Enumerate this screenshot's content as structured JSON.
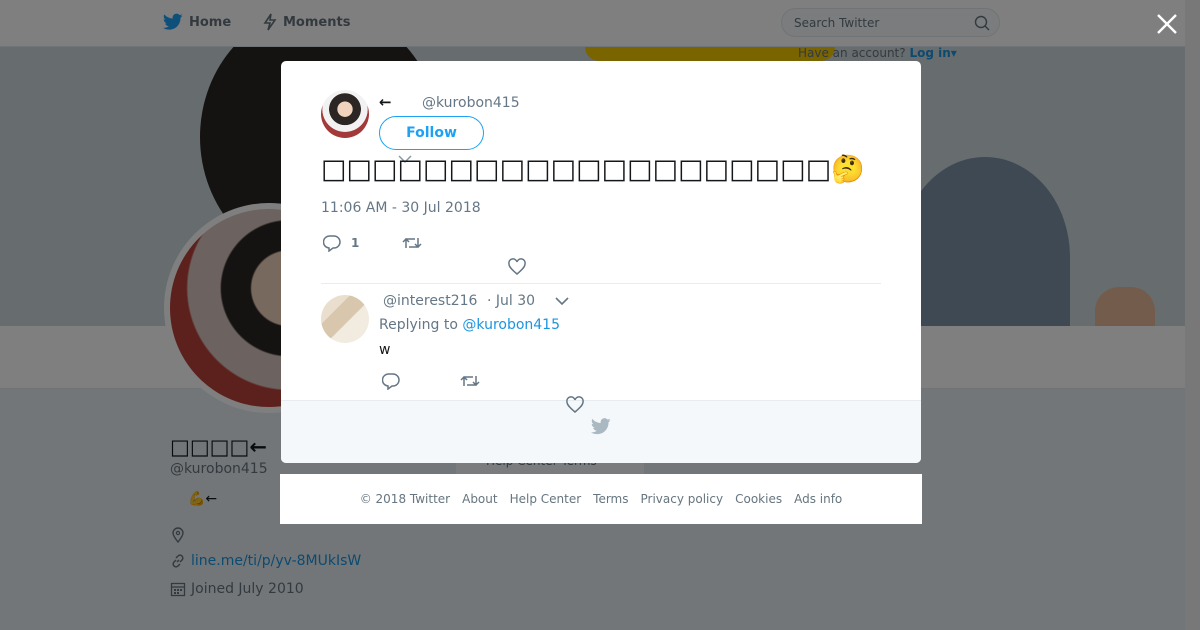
{
  "brand": {
    "accent": "#1da1f2",
    "link": "#1b95e0"
  },
  "topbar": {
    "home_label": "Home",
    "moments_label": "Moments",
    "search_placeholder": "Search Twitter",
    "account_prompt": "Have an account?",
    "login_label": "Log in"
  },
  "profile": {
    "name": "□□□□←",
    "handle": "@kurobon415",
    "bio": "💪←",
    "link": "line.me/ti/p/yv-8MUkIsW",
    "joined": "Joined July 2010"
  },
  "background_card": {
    "text": "Help Center  Terms"
  },
  "tweet": {
    "author_name": "←",
    "author_handle": "@kurobon415",
    "follow_label": "Follow",
    "text": "□□□□□□□□□□□□□□□□□□□□🤔",
    "timestamp": "11:06 AM - 30 Jul 2018",
    "reply_count": "1"
  },
  "reply": {
    "handle": "@interest216",
    "date": "· Jul 30",
    "replying_prefix": "Replying to",
    "replying_handle": "@kurobon415",
    "text": "w"
  },
  "legal_links": [
    "© 2018 Twitter",
    "About",
    "Help Center",
    "Terms",
    "Privacy policy",
    "Cookies",
    "Ads info"
  ],
  "icons": {
    "home": "bird-icon",
    "moments": "lightning-icon",
    "search": "search-icon",
    "close": "close-icon",
    "reply": "reply-icon",
    "retweet": "retweet-icon",
    "like": "heart-icon",
    "location": "location-pin-icon",
    "link": "link-icon",
    "calendar": "calendar-icon"
  }
}
